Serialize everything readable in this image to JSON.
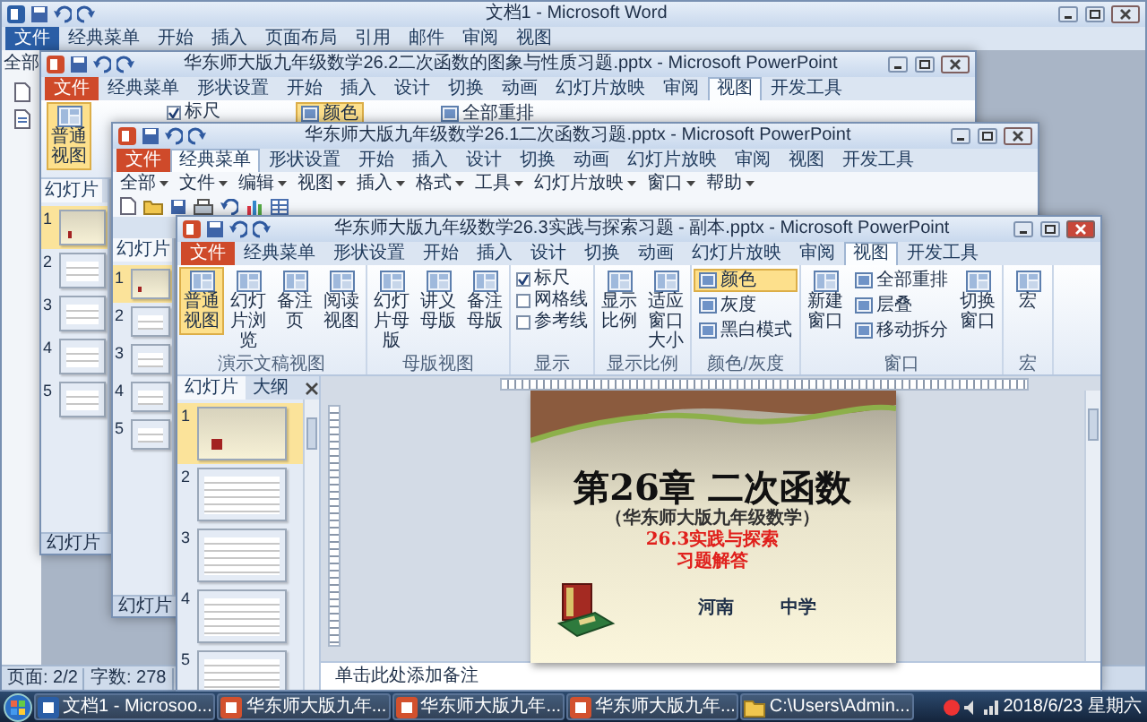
{
  "word_window": {
    "title": "文档1 - Microsoft Word",
    "tabs": [
      {
        "label": "文件",
        "kind": "file",
        "selected": false
      },
      {
        "label": "经典菜单",
        "kind": "tab",
        "selected": false
      },
      {
        "label": "开始",
        "kind": "tab",
        "selected": false
      },
      {
        "label": "插入",
        "kind": "tab",
        "selected": false
      },
      {
        "label": "页面布局",
        "kind": "tab",
        "selected": false
      },
      {
        "label": "引用",
        "kind": "tab",
        "selected": false
      },
      {
        "label": "邮件",
        "kind": "tab",
        "selected": false
      },
      {
        "label": "审阅",
        "kind": "tab",
        "selected": false
      },
      {
        "label": "视图",
        "kind": "tab",
        "selected": false
      }
    ],
    "menu_label": "全部",
    "status_bar": [
      "页面: 2/2",
      "字数: 278"
    ]
  },
  "back_window": {
    "title": "华东师大版九年级数学26.2二次函数的图象与性质习题.pptx - Microsoft PowerPoint",
    "tabs": [
      {
        "label": "文件",
        "kind": "file",
        "selected": false
      },
      {
        "label": "经典菜单",
        "kind": "tab",
        "selected": false
      },
      {
        "label": "形状设置",
        "kind": "tab",
        "selected": false
      },
      {
        "label": "开始",
        "kind": "tab",
        "selected": false
      },
      {
        "label": "插入",
        "kind": "tab",
        "selected": false
      },
      {
        "label": "设计",
        "kind": "tab",
        "selected": false
      },
      {
        "label": "切换",
        "kind": "tab",
        "selected": false
      },
      {
        "label": "动画",
        "kind": "tab",
        "selected": false
      },
      {
        "label": "幻灯片放映",
        "kind": "tab",
        "selected": false
      },
      {
        "label": "审阅",
        "kind": "tab",
        "selected": false
      },
      {
        "label": "视图",
        "kind": "tab",
        "selected": true
      },
      {
        "label": "开发工具",
        "kind": "tab",
        "selected": false
      }
    ],
    "ribbon": [
      {
        "label": "普通视图",
        "kind": "large",
        "selected": true
      },
      {
        "label": "标尺",
        "kind": "check",
        "checked": true
      },
      {
        "label": "颜色",
        "kind": "small",
        "selected": true
      },
      {
        "label": "全部重排",
        "kind": "small",
        "selected": false
      }
    ],
    "pane_tab": "幻灯片",
    "slides": [
      {
        "number": "1",
        "selected": true
      },
      {
        "number": "2",
        "selected": false
      },
      {
        "number": "3",
        "selected": false
      },
      {
        "number": "4",
        "selected": false
      },
      {
        "number": "5",
        "selected": false
      }
    ],
    "status": "幻灯片"
  },
  "middle_window": {
    "title": "华东师大版九年级数学26.1二次函数习题.pptx - Microsoft PowerPoint",
    "tabs": [
      {
        "label": "文件",
        "kind": "file",
        "selected": false
      },
      {
        "label": "经典菜单",
        "kind": "tab",
        "selected": true
      },
      {
        "label": "形状设置",
        "kind": "tab",
        "selected": false
      },
      {
        "label": "开始",
        "kind": "tab",
        "selected": false
      },
      {
        "label": "插入",
        "kind": "tab",
        "selected": false
      },
      {
        "label": "设计",
        "kind": "tab",
        "selected": false
      },
      {
        "label": "切换",
        "kind": "tab",
        "selected": false
      },
      {
        "label": "动画",
        "kind": "tab",
        "selected": false
      },
      {
        "label": "幻灯片放映",
        "kind": "tab",
        "selected": false
      },
      {
        "label": "审阅",
        "kind": "tab",
        "selected": false
      },
      {
        "label": "视图",
        "kind": "tab",
        "selected": false
      },
      {
        "label": "开发工具",
        "kind": "tab",
        "selected": false
      }
    ],
    "menu": [
      "全部",
      "文件",
      "编辑",
      "视图",
      "插入",
      "格式",
      "工具",
      "幻灯片放映",
      "窗口",
      "帮助"
    ],
    "pane_tab": "幻灯片",
    "slides": [
      {
        "number": "1",
        "selected": true
      },
      {
        "number": "2",
        "selected": false
      },
      {
        "number": "3",
        "selected": false
      },
      {
        "number": "4",
        "selected": false
      },
      {
        "number": "5",
        "selected": false
      }
    ],
    "status": "幻灯片"
  },
  "front_window": {
    "title": "华东师大版九年级数学26.3实践与探索习题 - 副本.pptx - Microsoft PowerPoint",
    "tabs": [
      {
        "label": "文件",
        "kind": "file",
        "selected": false
      },
      {
        "label": "经典菜单",
        "kind": "tab",
        "selected": false
      },
      {
        "label": "形状设置",
        "kind": "tab",
        "selected": false
      },
      {
        "label": "开始",
        "kind": "tab",
        "selected": false
      },
      {
        "label": "插入",
        "kind": "tab",
        "selected": false
      },
      {
        "label": "设计",
        "kind": "tab",
        "selected": false
      },
      {
        "label": "切换",
        "kind": "tab",
        "selected": false
      },
      {
        "label": "动画",
        "kind": "tab",
        "selected": false
      },
      {
        "label": "幻灯片放映",
        "kind": "tab",
        "selected": false
      },
      {
        "label": "审阅",
        "kind": "tab",
        "selected": false
      },
      {
        "label": "视图",
        "kind": "tab",
        "selected": true
      },
      {
        "label": "开发工具",
        "kind": "tab",
        "selected": false
      }
    ],
    "ribbon_groups": [
      {
        "label": "演示文稿视图",
        "items": [
          {
            "label": "普通视图",
            "kind": "large",
            "selected": true
          },
          {
            "label": "幻灯片浏览",
            "kind": "large",
            "selected": false
          },
          {
            "label": "备注页",
            "kind": "large",
            "selected": false
          },
          {
            "label": "阅读视图",
            "kind": "large",
            "selected": false
          }
        ]
      },
      {
        "label": "母版视图",
        "items": [
          {
            "label": "幻灯片母版",
            "kind": "large",
            "selected": false
          },
          {
            "label": "讲义母版",
            "kind": "large",
            "selected": false
          },
          {
            "label": "备注母版",
            "kind": "large",
            "selected": false
          }
        ]
      },
      {
        "label": "显示",
        "items": [
          {
            "label": "标尺",
            "kind": "check",
            "checked": true
          },
          {
            "label": "网格线",
            "kind": "check",
            "checked": false
          },
          {
            "label": "参考线",
            "kind": "check",
            "checked": false
          }
        ]
      },
      {
        "label": "显示比例",
        "items": [
          {
            "label": "显示比例",
            "kind": "large",
            "selected": false
          },
          {
            "label": "适应窗口大小",
            "kind": "large",
            "selected": false
          }
        ]
      },
      {
        "label": "颜色/灰度",
        "items": [
          {
            "label": "颜色",
            "kind": "small",
            "selected": true
          },
          {
            "label": "灰度",
            "kind": "small",
            "selected": false
          },
          {
            "label": "黑白模式",
            "kind": "small",
            "selected": false
          }
        ]
      },
      {
        "label": "窗口",
        "items": [
          {
            "label": "新建窗口",
            "kind": "large",
            "selected": false
          },
          {
            "label": "全部重排",
            "kind": "small",
            "selected": false
          },
          {
            "label": "层叠",
            "kind": "small",
            "selected": false
          },
          {
            "label": "移动拆分",
            "kind": "small",
            "selected": false
          },
          {
            "label": "切换窗口",
            "kind": "large",
            "selected": false
          }
        ]
      },
      {
        "label": "宏",
        "items": [
          {
            "label": "宏",
            "kind": "large",
            "selected": false
          }
        ]
      }
    ],
    "pane_tabs": [
      {
        "label": "幻灯片",
        "selected": true
      },
      {
        "label": "大纲",
        "selected": false
      }
    ],
    "slides": [
      {
        "number": "1",
        "selected": true
      },
      {
        "number": "2",
        "selected": false
      },
      {
        "number": "3",
        "selected": false
      },
      {
        "number": "4",
        "selected": false
      },
      {
        "number": "5",
        "selected": false
      }
    ],
    "slide": {
      "title": "第26章 二次函数",
      "subtitle": "（华东师大版九年级数学）",
      "red_lines": [
        "26.3实践与探索",
        "习题解答"
      ],
      "footer": [
        "河南",
        "中学"
      ]
    },
    "notes_placeholder": "单击此处添加备注"
  },
  "taskbar": {
    "items": [
      {
        "label": "文档1 - Microsoo...",
        "kind": "word"
      },
      {
        "label": "华东师大版九年...",
        "kind": "powerpoint"
      },
      {
        "label": "华东师大版九年...",
        "kind": "powerpoint"
      },
      {
        "label": "华东师大版九年...",
        "kind": "powerpoint"
      },
      {
        "label": "C:\\Users\\Admin...",
        "kind": "folder"
      }
    ],
    "clock": "2018/6/23 星期六"
  }
}
